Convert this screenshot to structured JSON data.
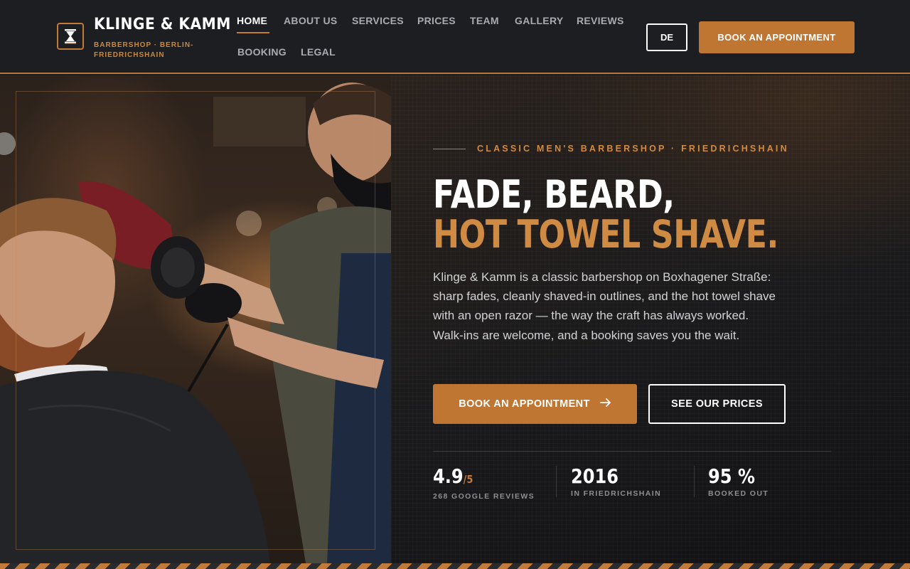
{
  "brand": {
    "name": "KLINGE & KAMM",
    "tagline": "BARBERSHOP · BERLIN-FRIEDRICHSHAIN"
  },
  "nav": {
    "items": [
      {
        "label": "HOME",
        "active": true
      },
      {
        "label": "ABOUT US"
      },
      {
        "label": "SERVICES"
      },
      {
        "label": "PRICES"
      },
      {
        "label": "TEAM"
      },
      {
        "label": "GALLERY"
      },
      {
        "label": "REVIEWS"
      },
      {
        "label": "BOOKING"
      },
      {
        "label": "LEGAL"
      }
    ]
  },
  "header": {
    "language_label": "DE",
    "cta_label": "BOOK AN APPOINTMENT"
  },
  "hero": {
    "eyebrow": "CLASSIC MEN'S BARBERSHOP · FRIEDRICHSHAIN",
    "headline_line1": "FADE, BEARD,",
    "headline_line2": "HOT TOWEL SHAVE.",
    "lead": "Klinge & Kamm is a classic barbershop on Boxhagener Straße: sharp fades, cleanly shaved-in outlines, and the hot towel shave with an open razor — the way the craft has always worked. Walk-ins are welcome, and a booking saves you the wait.",
    "primary_button": "BOOK AN APPOINTMENT",
    "primary_button_icon": "arrow-right-icon",
    "secondary_button": "SEE OUR PRICES"
  },
  "stats": [
    {
      "value": "4.9",
      "unit": "/5",
      "label": "268 GOOGLE REVIEWS"
    },
    {
      "value": "2016",
      "unit": "",
      "label": "IN FRIEDRICHSHAIN"
    },
    {
      "value": "95 %",
      "unit": "",
      "label": "BOOKED OUT"
    }
  ],
  "colors": {
    "accent": "#bf7632",
    "accent_text": "#cf8a44",
    "background": "#1c1d21"
  }
}
